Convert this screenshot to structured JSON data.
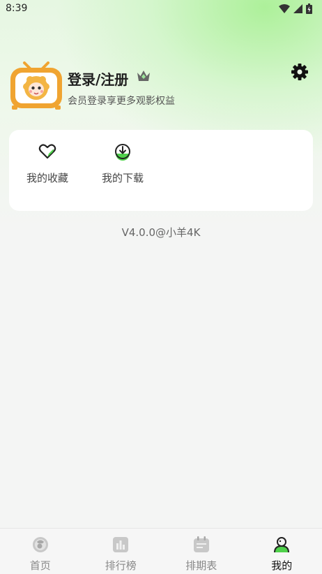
{
  "status_bar": {
    "time": "8:39"
  },
  "profile": {
    "login_label": "登录/注册",
    "subtitle": "会员登录享更多观影权益"
  },
  "card": {
    "items": [
      {
        "label": "我的收藏",
        "icon": "heart-icon"
      },
      {
        "label": "我的下载",
        "icon": "download-icon"
      }
    ]
  },
  "version_text": "V4.0.0@小羊4K",
  "nav": {
    "items": [
      {
        "label": "首页",
        "icon": "home-icon",
        "active": false
      },
      {
        "label": "排行榜",
        "icon": "ranking-icon",
        "active": false
      },
      {
        "label": "排期表",
        "icon": "calendar-icon",
        "active": false
      },
      {
        "label": "我的",
        "icon": "profile-icon",
        "active": true
      }
    ]
  },
  "colors": {
    "accent": "#4fd14b",
    "avatar_orange": "#f0a431",
    "text_active": "#111111",
    "text_inactive": "#888888"
  }
}
